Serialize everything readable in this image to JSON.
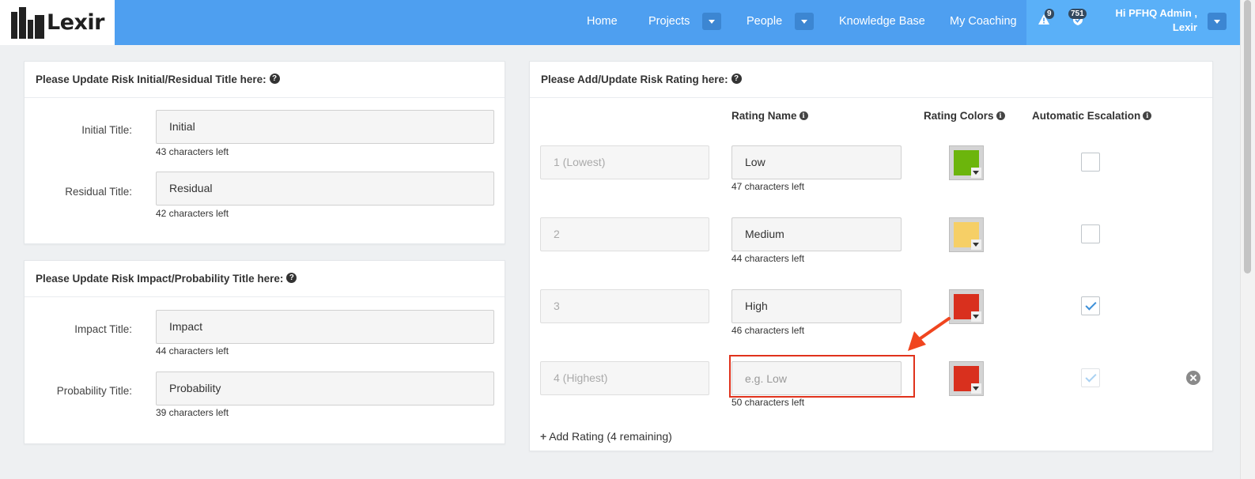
{
  "brand": {
    "name": "Lexir"
  },
  "nav": {
    "items": [
      "Home",
      "Projects",
      "People",
      "Knowledge Base",
      "My Coaching"
    ],
    "alerts_count": "9",
    "tasks_count": "751",
    "user_line1": "Hi PFHQ Admin ,",
    "user_line2": "Lexir"
  },
  "panel_titles": {
    "title": "Please Update Risk Initial/Residual Title here:",
    "fields": [
      {
        "label": "Initial Title:",
        "value": "Initial",
        "hint": "43 characters left"
      },
      {
        "label": "Residual Title:",
        "value": "Residual",
        "hint": "42 characters left"
      }
    ]
  },
  "panel_impact": {
    "title": "Please Update Risk Impact/Probability Title here:",
    "fields": [
      {
        "label": "Impact Title:",
        "value": "Impact",
        "hint": "44 characters left"
      },
      {
        "label": "Probability Title:",
        "value": "Probability",
        "hint": "39 characters left"
      }
    ]
  },
  "panel_rating": {
    "title": "Please Add/Update Risk Rating here:",
    "columns": {
      "name": "Rating Name",
      "colors": "Rating Colors",
      "escalation": "Automatic Escalation"
    },
    "rows": [
      {
        "level": "1 (Lowest)",
        "name": "Low",
        "placeholder": "",
        "hint": "47 characters left",
        "color": "#6cb50c",
        "escalation": false
      },
      {
        "level": "2",
        "name": "Medium",
        "placeholder": "",
        "hint": "44 characters left",
        "color": "#f6cf66",
        "escalation": false
      },
      {
        "level": "3",
        "name": "High",
        "placeholder": "",
        "hint": "46 characters left",
        "color": "#d9301e",
        "escalation": true
      },
      {
        "level": "4 (Highest)",
        "name": "",
        "placeholder": "e.g. Low",
        "hint": "50 characters left",
        "color": "#d9301e",
        "escalation": true
      }
    ],
    "add_label": "Add Rating (4 remaining)"
  },
  "colors": {
    "nav_bg": "#4e9ff0",
    "highlight": "#e0321c",
    "check": "#3b8fd8"
  },
  "icons": [
    "logo-buildings-icon",
    "warning-icon",
    "shield-check-icon",
    "question-circle-icon",
    "info-circle-icon",
    "plus-icon",
    "remove-circle-icon",
    "caret-down-icon"
  ]
}
